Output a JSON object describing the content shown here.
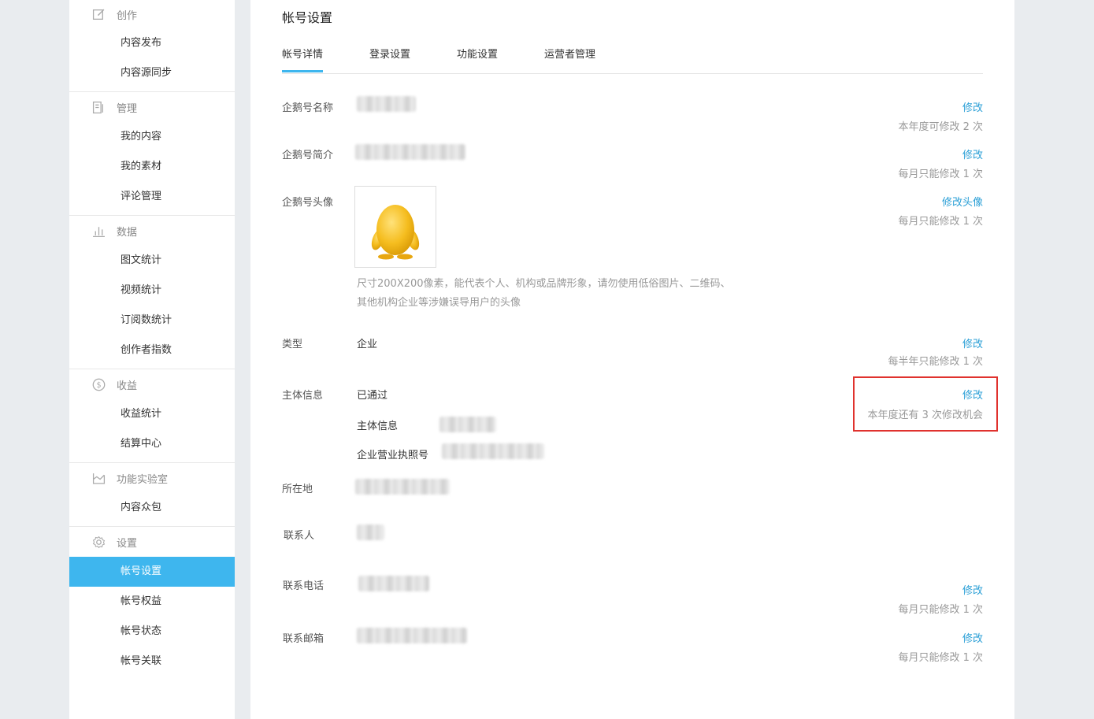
{
  "sidebar": {
    "groups": [
      {
        "title": "创作",
        "icon": "edit-icon",
        "items": [
          "内容发布",
          "内容源同步"
        ]
      },
      {
        "title": "管理",
        "icon": "manage-icon",
        "items": [
          "我的内容",
          "我的素材",
          "评论管理"
        ]
      },
      {
        "title": "数据",
        "icon": "bar-chart-icon",
        "items": [
          "图文统计",
          "视频统计",
          "订阅数统计",
          "创作者指数"
        ]
      },
      {
        "title": "收益",
        "icon": "dollar-icon",
        "items": [
          "收益统计",
          "结算中心"
        ]
      },
      {
        "title": "功能实验室",
        "icon": "lab-icon",
        "items": [
          "内容众包"
        ]
      },
      {
        "title": "设置",
        "icon": "gear-icon",
        "items": [
          "帐号设置",
          "帐号权益",
          "帐号状态",
          "帐号关联"
        ]
      }
    ],
    "active_item": "帐号设置"
  },
  "main": {
    "title": "帐号设置",
    "tabs": [
      "帐号详情",
      "登录设置",
      "功能设置",
      "运营者管理"
    ],
    "active_tab": "帐号详情",
    "fields": {
      "name": {
        "label": "企鹅号名称",
        "link": "修改",
        "note": "本年度可修改 2 次"
      },
      "intro": {
        "label": "企鹅号简介",
        "link": "修改",
        "note": "每月只能修改 1 次"
      },
      "avatar": {
        "label": "企鹅号头像",
        "link": "修改头像",
        "note": "每月只能修改 1 次",
        "hint_line1": "尺寸200X200像素，能代表个人、机构或品牌形象，请勿使用低俗图片、二维码、",
        "hint_line2": "其他机构企业等涉嫌误导用户的头像"
      },
      "type": {
        "label": "类型",
        "value": "企业",
        "link": "修改",
        "note": "每半年只能修改 1 次"
      },
      "entity": {
        "label": "主体信息",
        "value": "已通过",
        "link": "修改",
        "note": "本年度还有 3 次修改机会",
        "sub_info_label": "主体信息",
        "sub_license_label": "企业营业执照号"
      },
      "location": {
        "label": "所在地"
      },
      "contact": {
        "label": "联系人"
      },
      "phone": {
        "label": "联系电话",
        "link": "修改",
        "note": "每月只能修改 1 次"
      },
      "email": {
        "label": "联系邮箱",
        "link": "修改",
        "note": "每月只能修改 1 次"
      }
    }
  },
  "colors": {
    "accent": "#3eb6ee",
    "link": "#2a9fd6",
    "highlight": "#e0322e"
  }
}
